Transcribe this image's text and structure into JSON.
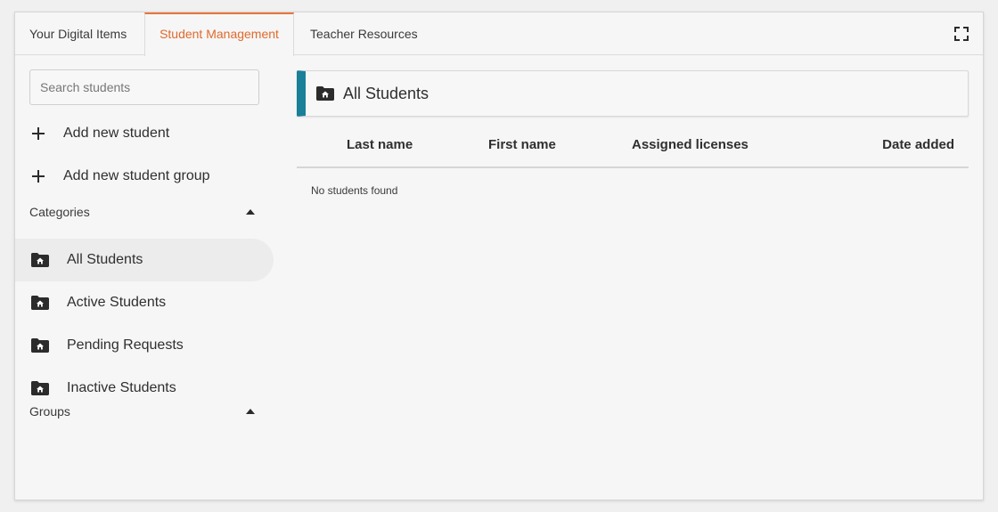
{
  "tabs": [
    {
      "label": "Your Digital Items"
    },
    {
      "label": "Student Management"
    },
    {
      "label": "Teacher Resources"
    }
  ],
  "colors": {
    "active_tab": "#e06a2c",
    "accent_bar": "#1a7f98"
  },
  "sidebar": {
    "search_placeholder": "Search students",
    "add_student_label": "Add new student",
    "add_group_label": "Add new student group",
    "categories_label": "Categories",
    "categories": [
      {
        "label": "All Students"
      },
      {
        "label": "Active Students"
      },
      {
        "label": "Pending Requests"
      },
      {
        "label": "Inactive Students"
      }
    ],
    "groups_label": "Groups"
  },
  "main": {
    "title": "All Students",
    "columns": [
      "Last name",
      "First name",
      "Assigned licenses",
      "Date added"
    ],
    "empty_message": "No students found"
  }
}
